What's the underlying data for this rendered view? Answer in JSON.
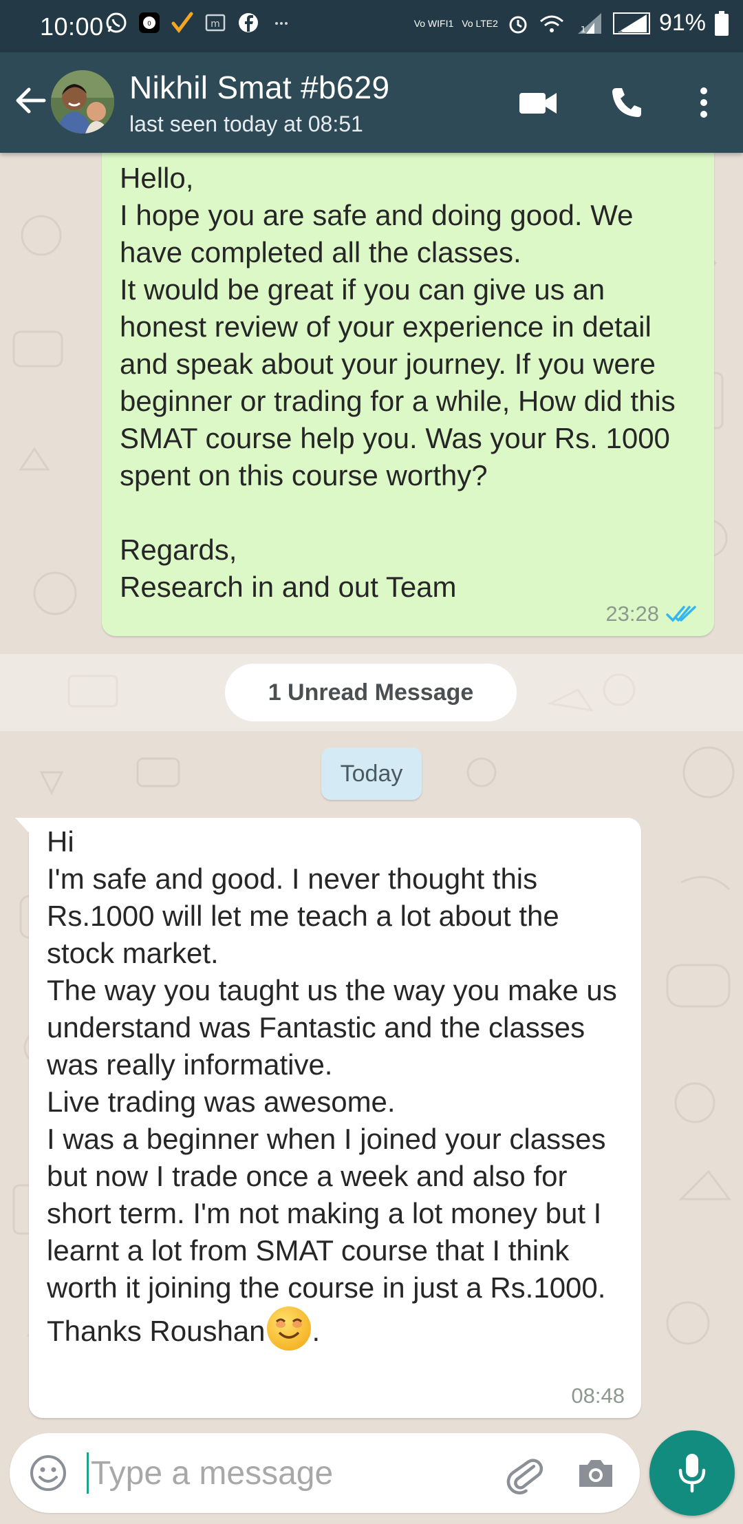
{
  "status_bar": {
    "time": "10:00",
    "network_labels": [
      "Vo WIFI1",
      "Vo LTE2"
    ],
    "battery": "91%",
    "icons": [
      "whatsapp-icon",
      "app-icon",
      "check-icon",
      "messenger-icon",
      "facebook-icon",
      "more-dots-icon",
      "alarm-icon",
      "wifi-icon",
      "signal-sim1-icon",
      "signal-sim2-icon",
      "battery-icon"
    ]
  },
  "header": {
    "contact_name": "Nikhil Smat #b629",
    "status": "last seen today at 08:51",
    "icons": [
      "back-arrow-icon",
      "video-call-icon",
      "voice-call-icon",
      "overflow-menu-icon"
    ]
  },
  "messages": [
    {
      "direction": "outgoing",
      "text": "Hello,\nI hope you are safe and doing good. We have completed all the classes.\nIt would be great if you can give us an honest review of your experience in detail and speak about your journey. If you were beginner or trading for a while, How did this SMAT course help you. Was your Rs. 1000 spent on this course worthy?\n\nRegards,\nResearch in and out Team",
      "time": "23:28",
      "status": "read"
    },
    {
      "direction": "incoming",
      "text": "Hi\nI'm safe and good. I never thought this Rs.1000 will let me teach a lot about the stock market.\nThe way you taught us the way you make us understand was Fantastic and the classes was really informative.\nLive trading was awesome.\nI was a beginner when I joined your classes but now I trade once a week and also for short term. I'm not making a lot money but I learnt a lot from SMAT course that I think worth it joining the course in just a Rs.1000. Thanks Roushan",
      "text_suffix": ".",
      "time": "08:48"
    }
  ],
  "unread_label": "1 Unread Message",
  "date_label": "Today",
  "input": {
    "placeholder": "Type a message",
    "value": ""
  },
  "colors": {
    "app_bar": "#2e4a57",
    "status_bar": "#233a46",
    "outgoing_bubble": "#dcf8c6",
    "incoming_bubble": "#ffffff",
    "accent": "#128c7e",
    "read_ticks": "#34b7f1"
  }
}
